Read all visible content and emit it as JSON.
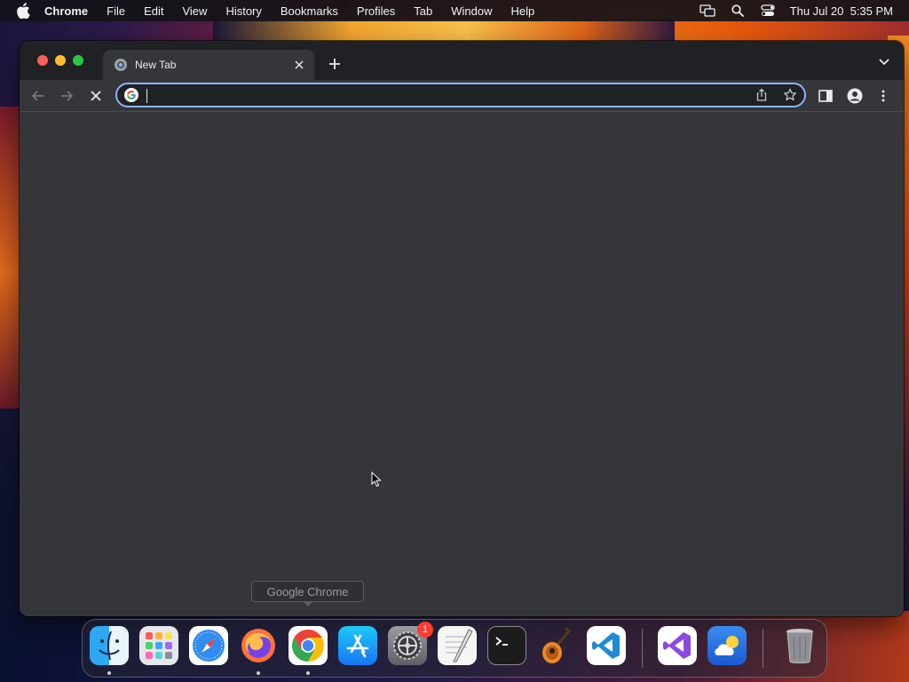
{
  "menubar": {
    "app_name": "Chrome",
    "items": [
      "File",
      "Edit",
      "View",
      "History",
      "Bookmarks",
      "Profiles",
      "Tab",
      "Window",
      "Help"
    ],
    "clock": "Thu Jul 20  5:35 PM",
    "icons": [
      "apple-icon",
      "screen-mirroring-icon",
      "spotlight-search-icon",
      "control-center-icon"
    ]
  },
  "browser": {
    "tab": {
      "title": "New Tab",
      "icon": "chrome-new-tab-icon"
    },
    "omnibox": {
      "value": "",
      "placeholder": ""
    },
    "toolbar_icons": [
      "back-icon",
      "forward-icon",
      "stop-loading-icon",
      "share-icon",
      "bookmark-star-icon",
      "side-panel-icon",
      "profile-icon",
      "menu-icon"
    ],
    "theme": {
      "titlebar": "#202124",
      "surface": "#35363a",
      "focus": "#8ab4f8"
    }
  },
  "tooltip": {
    "text": "Google Chrome"
  },
  "dock": {
    "apps": [
      {
        "name": "Finder",
        "running": true
      },
      {
        "name": "Launchpad",
        "running": false
      },
      {
        "name": "Safari",
        "running": false
      },
      {
        "name": "Firefox",
        "running": true
      },
      {
        "name": "Google Chrome",
        "running": true
      },
      {
        "name": "App Store",
        "running": false
      },
      {
        "name": "System Settings",
        "running": false,
        "badge": "1"
      },
      {
        "name": "TextEdit",
        "running": false
      },
      {
        "name": "Terminal",
        "running": false
      },
      {
        "name": "GarageBand",
        "running": false
      },
      {
        "name": "Visual Studio Code",
        "running": false
      },
      {
        "name": "Visual Studio",
        "running": false
      },
      {
        "name": "Weather",
        "running": false
      },
      {
        "name": "Trash",
        "running": false
      }
    ]
  }
}
